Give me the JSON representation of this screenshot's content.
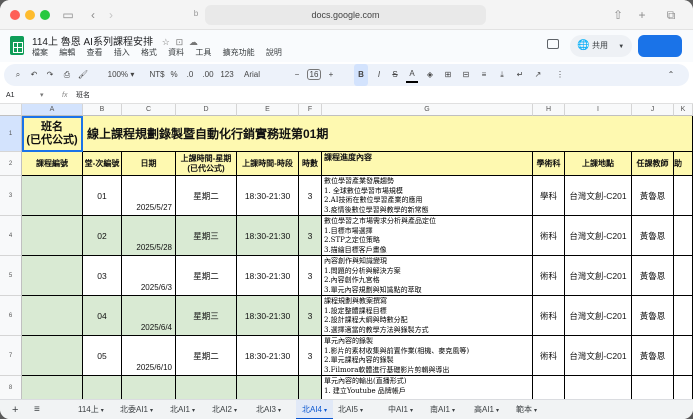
{
  "browser": {
    "url": "docs.google.com"
  },
  "doc": {
    "title": "114上 魯恩 AI系列課程安排",
    "menu": [
      "檔案",
      "編輯",
      "查看",
      "插入",
      "格式",
      "資料",
      "工具",
      "擴充功能",
      "說明"
    ],
    "share_label": "共用"
  },
  "toolbar": {
    "zoom": "100%",
    "currency": "NT$",
    "percent": "%",
    "dec_less": ".0",
    "dec_more": ".00",
    "number_format": "123",
    "font": "Arial",
    "font_size": "16",
    "minus": "−",
    "plus": "+",
    "bold": "B"
  },
  "formula_bar": {
    "cell_ref": "A1",
    "fx": "fx",
    "value": "班名"
  },
  "columns": [
    "A",
    "B",
    "C",
    "D",
    "E",
    "F",
    "G",
    "H",
    "I",
    "J",
    "K"
  ],
  "rows": [
    "1",
    "2",
    "3",
    "4",
    "5",
    "6",
    "7",
    "8"
  ],
  "sheet": {
    "a1": "班名\n(已代公式)",
    "title": "線上課程規劃錄製暨自動化行銷實務班第01期",
    "headers": {
      "a": "課程編號",
      "b": "堂-次編號",
      "c": "日期",
      "d": "上課時間-星期\n(已代公式)",
      "e": "上課時間-時段",
      "f": "時數",
      "g": "課程進度內容",
      "h": "學術科",
      "i": "上課地點",
      "j": "任課教師",
      "k": "助"
    },
    "records": [
      {
        "no": "01",
        "date": "2025/5/27",
        "day": "星期二",
        "time": "18:30-21:30",
        "hours": "3",
        "content": [
          "數位學習產業發展趨勢",
          "1. 全球數位學習市場規模",
          "2.AI技術在數位學習產業的應用",
          "3.疫情後數位學習與教學的新常態"
        ],
        "type": "學科",
        "place": "台灣文創-C201",
        "teacher": "黃魯恩"
      },
      {
        "no": "02",
        "date": "2025/5/28",
        "day": "星期三",
        "time": "18:30-21:30",
        "hours": "3",
        "content": [
          "數位學習之市場需求分析與產品定位",
          "1.目標市場選擇",
          "2.STP之定位策略",
          "3.描繪目標客戶畫像"
        ],
        "type": "術科",
        "place": "台灣文創-C201",
        "teacher": "黃魯恩"
      },
      {
        "no": "03",
        "date": "2025/6/3",
        "day": "星期二",
        "time": "18:30-21:30",
        "hours": "3",
        "content": [
          "內容創作與知識變現",
          "1.問題的分析與解決方案",
          "2.內容創作九宮格",
          "3.單元內容規劃與知識點的萃取"
        ],
        "type": "術科",
        "place": "台灣文創-C201",
        "teacher": "黃魯恩"
      },
      {
        "no": "04",
        "date": "2025/6/4",
        "day": "星期三",
        "time": "18:30-21:30",
        "hours": "3",
        "content": [
          "課程規劃與教案撰寫",
          "1.設定整體課程目標",
          "2.設計課程大綱與時數分配",
          "3.選擇適當的教學方法與錄製方式"
        ],
        "type": "術科",
        "place": "台灣文創-C201",
        "teacher": "黃魯恩"
      },
      {
        "no": "05",
        "date": "2025/6/10",
        "day": "星期二",
        "time": "18:30-21:30",
        "hours": "3",
        "content": [
          "單元內容的錄製",
          "1.影片的素材收集與前置作業(相機、麥克風等)",
          "2.單元課程內容的錄製",
          "3.Filmora軟體進行基礎影片剪輯與導出"
        ],
        "type": "術科",
        "place": "台灣文創-C201",
        "teacher": "黃魯恩"
      },
      {
        "no": "",
        "date": "",
        "day": "",
        "time": "",
        "hours": "",
        "content": [
          "單元內容的輸出(直播形式)",
          "1. 建立Youtube 品牌帳戶"
        ],
        "type": "",
        "place": "",
        "teacher": ""
      }
    ]
  },
  "tabs": {
    "add": "+",
    "list": "≡",
    "items": [
      "114上",
      "北委AI1",
      "北AI1",
      "北AI2",
      "北AI3",
      "北AI4",
      "北AI5",
      "中AI1",
      "南AI1",
      "高AI1",
      "範本"
    ],
    "active": "北AI4"
  },
  "colors": {
    "title_yellow": "#fef9b0",
    "green": "#d9ead3",
    "accent_blue": "#1a73e8"
  }
}
